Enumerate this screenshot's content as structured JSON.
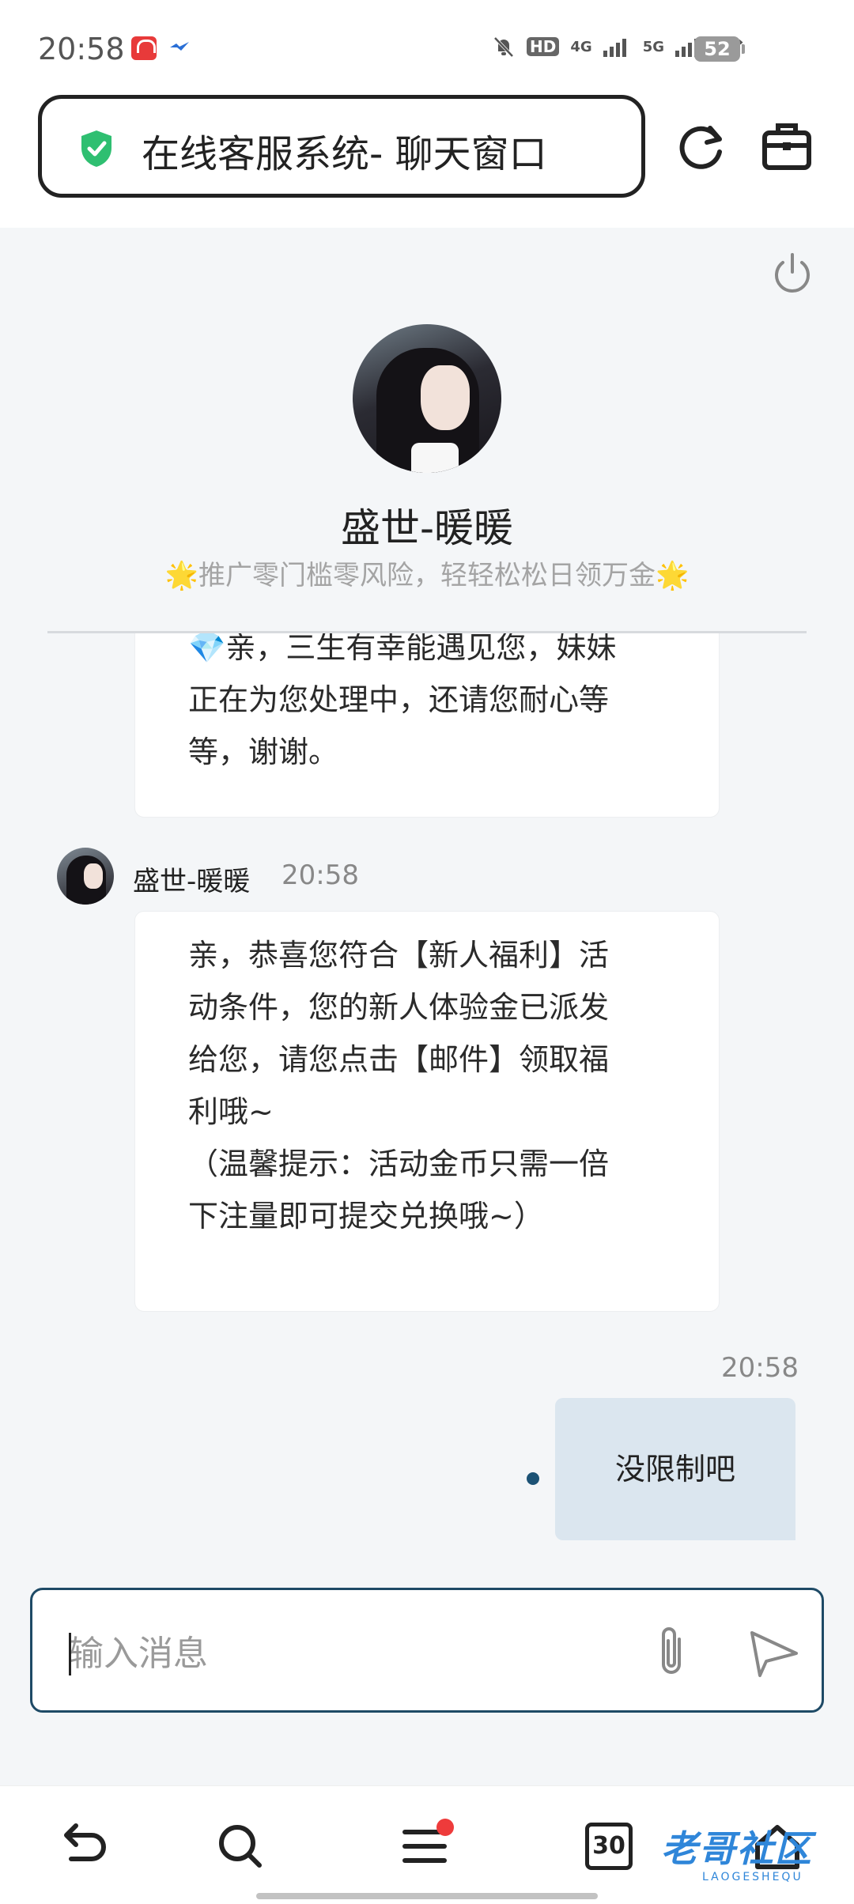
{
  "status_bar": {
    "time": "20:58",
    "battery": "52",
    "network_1": "4G",
    "network_2": "5G",
    "hd": "HD"
  },
  "header": {
    "title": "在线客服系统- 聊天窗口",
    "secure_icon": "shield-check-icon",
    "reload_icon": "reload-icon",
    "tools_icon": "briefcase-icon"
  },
  "agent": {
    "name": "盛世-暖暖",
    "slogan": "🌟推广零门槛零风险，轻轻松松日领万金🌟"
  },
  "messages": [
    {
      "from": "agent",
      "text": "💎亲，三生有幸能遇见您，妹妹\n正在为您处理中，还请您耐心等\n等，谢谢。"
    },
    {
      "from": "agent",
      "sender": "盛世-暖暖",
      "time": "20:58",
      "text": "亲，恭喜您符合【新人福利】活\n动条件，您的新人体验金已派发\n给您，请您点击【邮件】领取福\n利哦~\n（温馨提示：活动金币只需一倍\n下注量即可提交兑换哦~）"
    },
    {
      "from": "user",
      "time": "20:58",
      "text": "没限制吧"
    }
  ],
  "input": {
    "placeholder": "输入消息",
    "value": ""
  },
  "bottom_nav": {
    "tabs_count": "30",
    "watermark": "老哥社区",
    "watermark_sub": "LAOGESHEQU"
  },
  "colors": {
    "accent": "#1e4a66",
    "user_bubble": "#dbe6ef",
    "chat_bg": "#f4f6f8",
    "secure_green": "#2fbf71"
  }
}
